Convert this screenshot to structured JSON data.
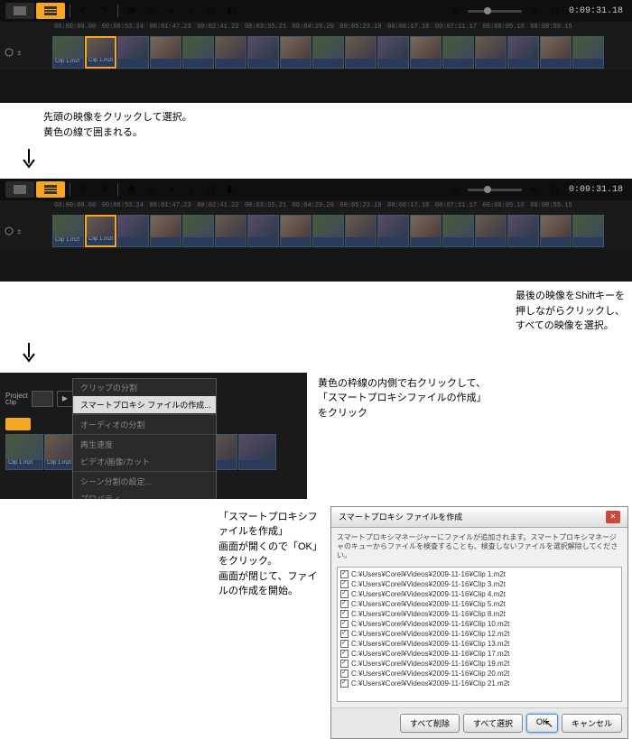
{
  "timecode": "0:09:31.18",
  "ruler": [
    "00:00:00.00",
    "00:00:53.24",
    "00:01:47.23",
    "00:02:41.22",
    "00:03:35.21",
    "00:04:29.20",
    "00:05:23.19",
    "00:06:17.18",
    "00:07:11.17",
    "00:08:05.16",
    "00:08:59.15"
  ],
  "clip_label": "Clip 1.m2t",
  "annotations": {
    "a1": "先頭の映像をクリックして選択。\n黄色の線で囲まれる。",
    "a2": "最後の映像をShiftキーを\n押しながらクリックし、\nすべての映像を選択。",
    "a3": "黄色の枠線の内側で右クリックして、\n「スマートプロキシファイルの作成」\nをクリック",
    "a4": "「スマートプロキシファイルを作成」\n画面が開くので「OK」をクリック。\n画面が閉じて、ファイルの作成を開始。"
  },
  "context_menu": {
    "items": [
      "クリップの分割",
      "スマートプロキシ ファイルの作成...",
      "オーディオの分割",
      "再生速度",
      "ビデオ/画像/カット",
      "シーン分割の設定...",
      "プロパティ..."
    ],
    "highlighted": 1
  },
  "project_label": "Project",
  "project_sublabel": "Clip",
  "dialog": {
    "title": "スマートプロキシ ファイルを作成",
    "desc": "スマートプロキシマネージャーにファイルが追加されます。スマートプロキシマネージャのキューからファイルを検査することも、検査しないファイルを選択解除してください。",
    "files": [
      "C:¥Users¥Corel¥Videos¥2009-11-16¥Clip 1.m2t",
      "C:¥Users¥Corel¥Videos¥2009-11-16¥Clip 3.m2t",
      "C:¥Users¥Corel¥Videos¥2009-11-16¥Clip 4.m2t",
      "C:¥Users¥Corel¥Videos¥2009-11-16¥Clip 5.m2t",
      "C:¥Users¥Corel¥Videos¥2009-11-16¥Clip 8.m2t",
      "C:¥Users¥Corel¥Videos¥2009-11-16¥Clip 10.m2t",
      "C:¥Users¥Corel¥Videos¥2009-11-16¥Clip 12.m2t",
      "C:¥Users¥Corel¥Videos¥2009-11-16¥Clip 13.m2t",
      "C:¥Users¥Corel¥Videos¥2009-11-16¥Clip 17.m2t",
      "C:¥Users¥Corel¥Videos¥2009-11-16¥Clip 19.m2t",
      "C:¥Users¥Corel¥Videos¥2009-11-16¥Clip 20.m2t",
      "C:¥Users¥Corel¥Videos¥2009-11-16¥Clip 21.m2t"
    ],
    "buttons": {
      "remove_all": "すべて削除",
      "select_all": "すべて選択",
      "ok": "OK",
      "cancel": "キャンセル"
    }
  }
}
